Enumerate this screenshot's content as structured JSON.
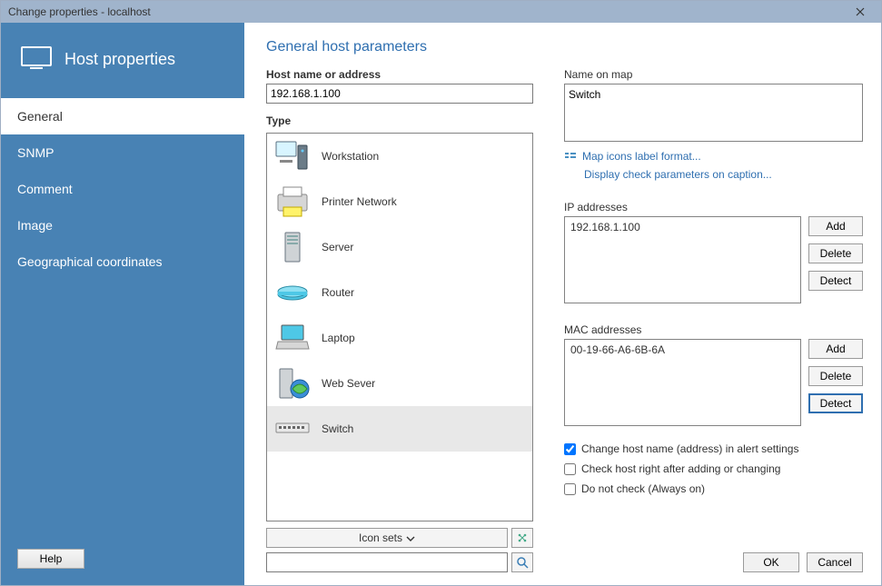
{
  "window": {
    "title": "Change properties - localhost"
  },
  "sidebar": {
    "title": "Host properties",
    "items": [
      {
        "label": "General",
        "active": true
      },
      {
        "label": "SNMP",
        "active": false
      },
      {
        "label": "Comment",
        "active": false
      },
      {
        "label": "Image",
        "active": false
      },
      {
        "label": "Geographical coordinates",
        "active": false
      }
    ],
    "help_label": "Help"
  },
  "page": {
    "title": "General host parameters",
    "host_label": "Host name or address",
    "host_value": "192.168.1.100",
    "type_label": "Type",
    "types": [
      {
        "label": "Workstation",
        "icon": "workstation"
      },
      {
        "label": "Printer Network",
        "icon": "printer"
      },
      {
        "label": "Server",
        "icon": "server"
      },
      {
        "label": "Router",
        "icon": "router"
      },
      {
        "label": "Laptop",
        "icon": "laptop"
      },
      {
        "label": "Web Sever",
        "icon": "webserver"
      },
      {
        "label": "Switch",
        "icon": "switch",
        "selected": true
      }
    ],
    "icon_sets_label": "Icon sets",
    "search_value": "",
    "name_on_map_label": "Name on map",
    "name_on_map_value": "Switch",
    "link_map_icons": "Map icons label format...",
    "link_display_check": "Display check parameters on caption...",
    "ip_label": "IP addresses",
    "ip_items": [
      "192.168.1.100"
    ],
    "mac_label": "MAC addresses",
    "mac_items": [
      "00-19-66-A6-6B-6A"
    ],
    "btn_add": "Add",
    "btn_delete": "Delete",
    "btn_detect": "Detect",
    "check1": {
      "label": "Change host name (address) in alert settings",
      "checked": true
    },
    "check2": {
      "label": "Check host right after adding or changing",
      "checked": false
    },
    "check3": {
      "label": "Do not check (Always on)",
      "checked": false
    }
  },
  "footer": {
    "ok": "OK",
    "cancel": "Cancel"
  }
}
